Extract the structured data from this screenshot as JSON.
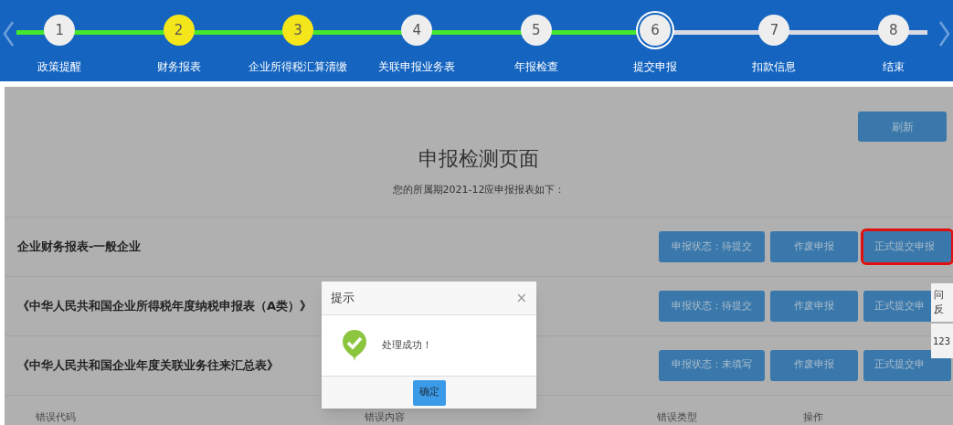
{
  "stepper": {
    "steps": [
      {
        "number": "1",
        "label": "政策提醒",
        "highlighted": false,
        "current": false
      },
      {
        "number": "2",
        "label": "财务报表",
        "highlighted": true,
        "current": false
      },
      {
        "number": "3",
        "label": "企业所得税汇算清缴",
        "highlighted": true,
        "current": false
      },
      {
        "number": "4",
        "label": "关联申报业务表",
        "highlighted": false,
        "current": false
      },
      {
        "number": "5",
        "label": "年报检查",
        "highlighted": false,
        "current": false
      },
      {
        "number": "6",
        "label": "提交申报",
        "highlighted": false,
        "current": true
      },
      {
        "number": "7",
        "label": "扣款信息",
        "highlighted": false,
        "current": false
      },
      {
        "number": "8",
        "label": "结束",
        "highlighted": false,
        "current": false
      }
    ]
  },
  "page": {
    "refresh_button": "刷新",
    "title": "申报检测页面",
    "subtitle": "您的所属期2021-12应申报报表如下："
  },
  "reports": [
    {
      "name": "企业财务报表-一般企业",
      "status_button": "申报状态：待提交",
      "void_button": "作废申报",
      "submit_button": "正式提交申报",
      "highlighted": true
    },
    {
      "name": "《中华人民共和国企业所得税年度纳税申报表（A类）》",
      "status_button": "申报状态：待提交",
      "void_button": "作废申报",
      "submit_button": "正式提交申",
      "highlighted": false
    },
    {
      "name": "《中华人民共和国企业年度关联业务往来汇总表》",
      "status_button": "申报状态：未填写",
      "void_button": "作废申报",
      "submit_button": "正式提交申",
      "highlighted": false
    }
  ],
  "error_table": {
    "columns": [
      "错误代码",
      "错误内容",
      "错误类型",
      "操作"
    ]
  },
  "side_panel": {
    "lines": [
      "问",
      "反"
    ],
    "number": "123"
  },
  "dialog": {
    "title": "提示",
    "close": "×",
    "message": "处理成功！",
    "ok_button": "确定"
  }
}
